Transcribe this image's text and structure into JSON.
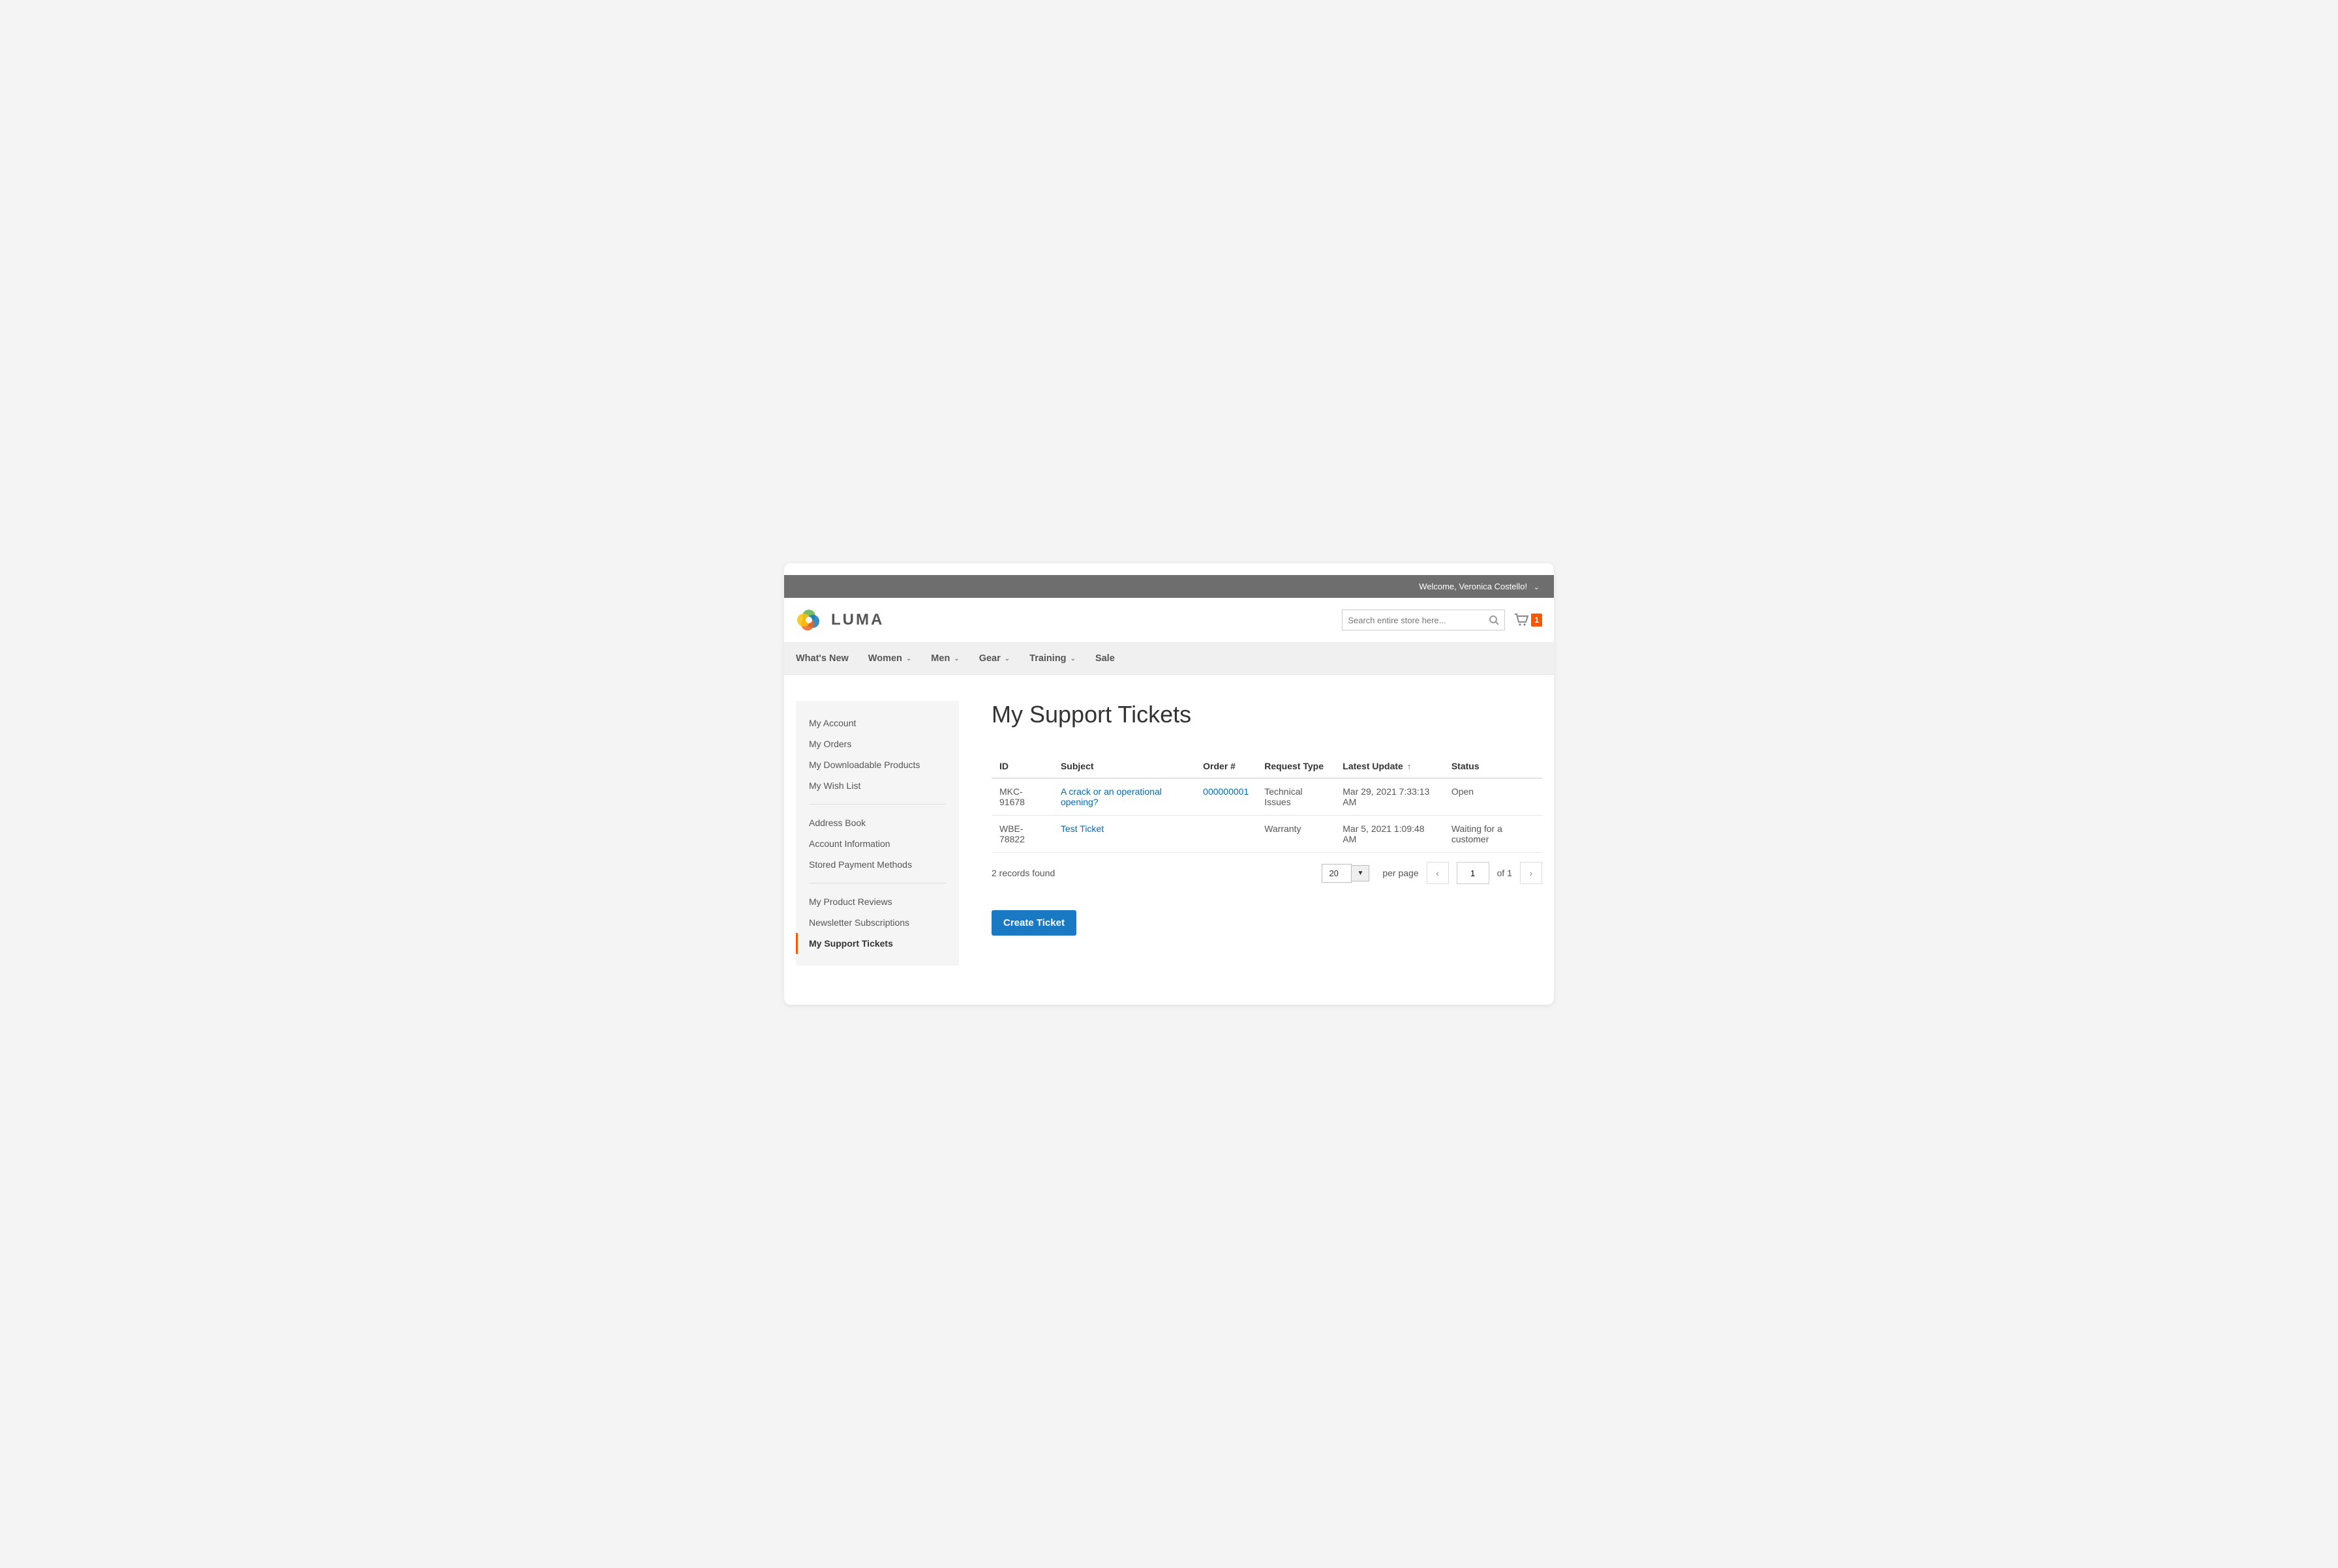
{
  "topbar": {
    "welcome": "Welcome, Veronica Costello!"
  },
  "brand": {
    "name": "LUMA"
  },
  "search": {
    "placeholder": "Search entire store here..."
  },
  "cart": {
    "count": "1"
  },
  "nav": [
    {
      "label": "What's New",
      "chevron": false
    },
    {
      "label": "Women",
      "chevron": true
    },
    {
      "label": "Men",
      "chevron": true
    },
    {
      "label": "Gear",
      "chevron": true
    },
    {
      "label": "Training",
      "chevron": true
    },
    {
      "label": "Sale",
      "chevron": false
    }
  ],
  "sidebar": {
    "groups": [
      [
        "My Account",
        "My Orders",
        "My Downloadable Products",
        "My Wish List"
      ],
      [
        "Address Book",
        "Account Information",
        "Stored Payment Methods"
      ],
      [
        "My Product Reviews",
        "Newsletter Subscriptions",
        "My Support Tickets"
      ]
    ],
    "active": "My Support Tickets"
  },
  "page": {
    "title": "My Support Tickets"
  },
  "table": {
    "columns": [
      "ID",
      "Subject",
      "Order #",
      "Request Type",
      "Latest Update",
      "Status"
    ],
    "sort_col": "Latest Update",
    "rows": [
      {
        "id": "MKC-91678",
        "subject": "A crack or an operational opening?",
        "order": "000000001",
        "type": "Technical Issues",
        "updated": "Mar 29, 2021 7:33:13 AM",
        "status": "Open"
      },
      {
        "id": "WBE-78822",
        "subject": "Test Ticket",
        "order": "",
        "type": "Warranty",
        "updated": "Mar 5, 2021 1:09:48 AM",
        "status": "Waiting for a customer"
      }
    ]
  },
  "footer": {
    "records_found": "2 records found",
    "per_page_value": "20",
    "per_page_label": "per page",
    "current_page": "1",
    "of_label": "of 1"
  },
  "buttons": {
    "create": "Create Ticket"
  }
}
